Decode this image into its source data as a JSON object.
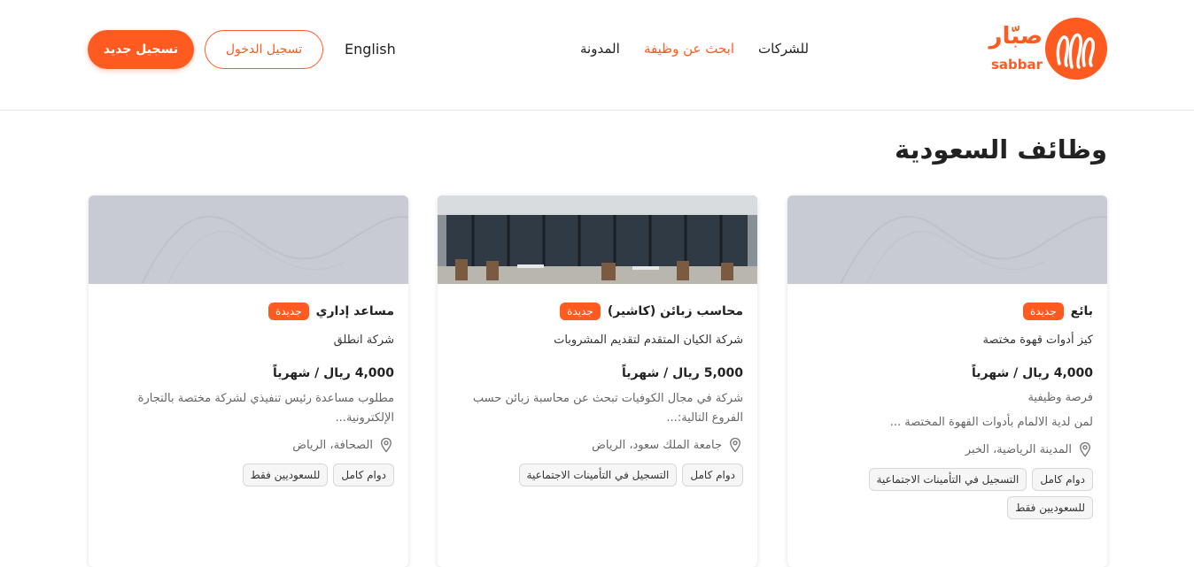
{
  "header": {
    "logo_ar": "صبّار",
    "logo_en": "sabbar",
    "nav": {
      "companies": "للشركات",
      "find_job": "ابحث عن وظيفة",
      "blog": "المدونة"
    },
    "language": "English",
    "login_label": "تسجيل الدخول",
    "signup_label": "تسجيل جديد"
  },
  "page_title": "وظائف السعودية",
  "colors": {
    "accent": "#ff5a1f",
    "placeholder": "#c9cbd4"
  },
  "jobs": [
    {
      "title": "بائع",
      "badge": "جديدة",
      "company": "كيز أدوات قهوة مختصة",
      "salary": "4,000 ريال / شهرياً",
      "subtitle": "فرصة وظيفية",
      "description": "لمن لدية الالمام بأدوات القهوة المختصة ...",
      "location": "المدينة الرياضية، الخبر",
      "tags": [
        "دوام كامل",
        "التسجيل في التأمينات الاجتماعية",
        "للسعوديين فقط"
      ]
    },
    {
      "title": "محاسب زبائن (كاشير)",
      "badge": "جديدة",
      "company": "شركة الكيان المتقدم لتقديم المشروبات",
      "salary": "5,000 ريال / شهرياً",
      "description": "شركة في مجال الكوفيات تبحث عن محاسبة زبائن حسب الفروع التالية:...",
      "location": "جامعة الملك سعود، الرياض",
      "tags": [
        "دوام كامل",
        "التسجيل في التأمينات الاجتماعية"
      ]
    },
    {
      "title": "مساعد إداري",
      "badge": "جديدة",
      "company": "شركة انطلق",
      "salary": "4,000 ريال / شهرياً",
      "description": "مطلوب مساعدة رئيس تنفيذي لشركة مختصة بالتجارة الإلكترونية...",
      "location": "الصحافة، الرياض",
      "tags": [
        "دوام كامل",
        "للسعوديين فقط"
      ]
    }
  ]
}
